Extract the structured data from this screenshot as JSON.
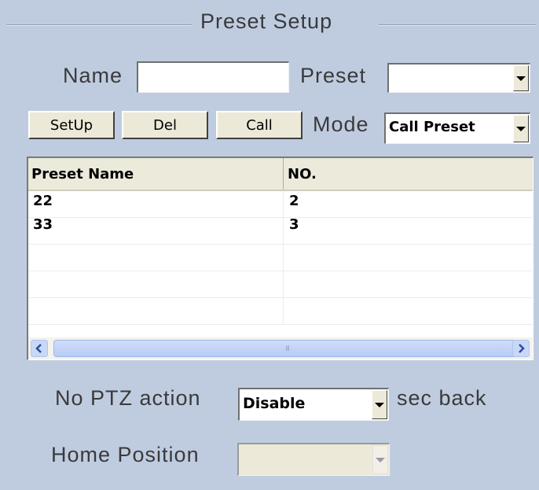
{
  "group": {
    "title": "Preset Setup"
  },
  "form": {
    "name_label": "Name",
    "name_value": "",
    "preset_label": "Preset",
    "preset_value": "",
    "mode_label": "Mode",
    "mode_value": "Call Preset"
  },
  "buttons": {
    "setup": "SetUp",
    "del": "Del",
    "call": "Call"
  },
  "table": {
    "headers": [
      "Preset Name",
      "NO."
    ],
    "rows": [
      {
        "name": "22",
        "no": "2"
      },
      {
        "name": "33",
        "no": "3"
      },
      {
        "name": "",
        "no": ""
      },
      {
        "name": "",
        "no": ""
      },
      {
        "name": "",
        "no": ""
      }
    ],
    "scroll_grip": "III"
  },
  "ptz": {
    "no_action_label": "No PTZ action",
    "no_action_value": "Disable",
    "sec_back_label": "sec back",
    "home_label": "Home Position",
    "home_value": ""
  },
  "colors": {
    "background": "#bfcce0",
    "button_face": "#ece9d8",
    "scroll_thumb": "#b8ccf3"
  }
}
